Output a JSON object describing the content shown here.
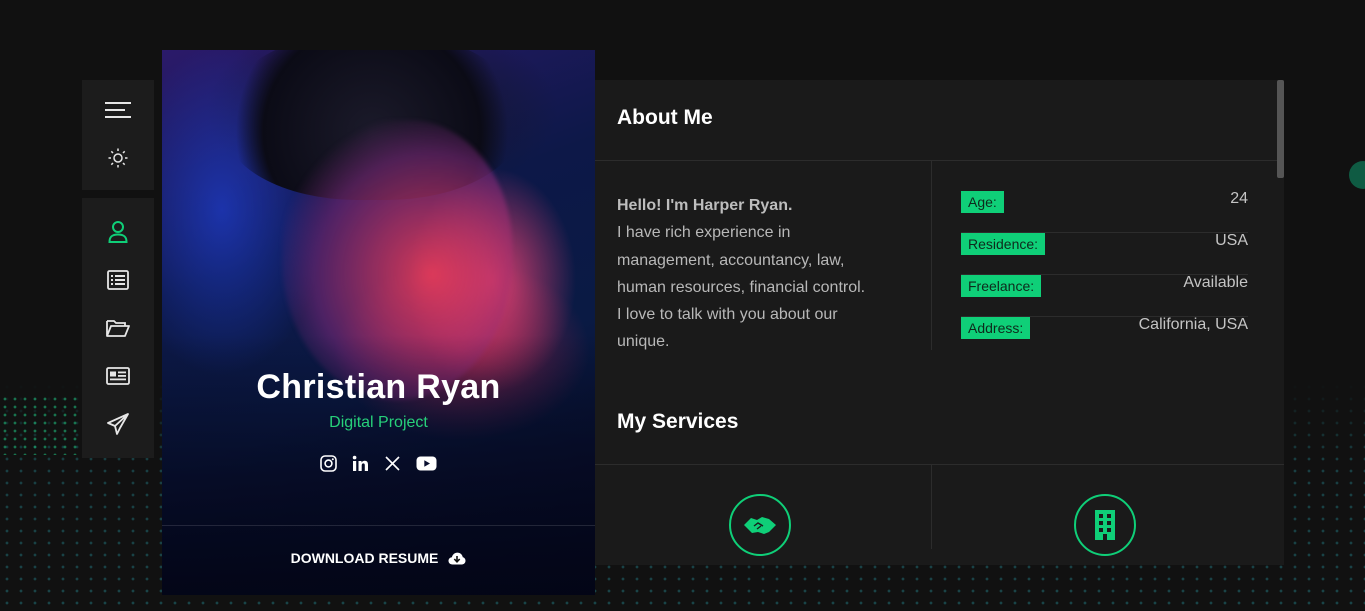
{
  "profile": {
    "name": "Christian Ryan",
    "role": "Digital Project",
    "download_label": "DOWNLOAD RESUME",
    "social": [
      "instagram-icon",
      "linkedin-icon",
      "x-icon",
      "youtube-icon"
    ]
  },
  "sidebar": {
    "top": [
      "menu-icon",
      "sun-icon"
    ],
    "items": [
      "user-icon",
      "resume-icon",
      "folder-icon",
      "news-icon",
      "send-icon"
    ],
    "active": "user-icon"
  },
  "about": {
    "title": "About Me",
    "greeting": "Hello! I'm Harper Ryan.",
    "lines": [
      "I have rich experience in",
      "management, accountancy, law,",
      "human resources, financial control.",
      "I love to talk with you about our",
      "unique."
    ],
    "info": [
      {
        "label": "Age:",
        "value": "24"
      },
      {
        "label": "Residence:",
        "value": "USA"
      },
      {
        "label": "Freelance:",
        "value": "Available"
      },
      {
        "label": "Address:",
        "value": "California, USA"
      }
    ]
  },
  "services": {
    "title": "My Services",
    "icons": [
      "handshake-icon",
      "building-icon"
    ]
  },
  "colors": {
    "accent": "#0fcf78",
    "background": "#111111",
    "panel": "#1a1a1a"
  }
}
